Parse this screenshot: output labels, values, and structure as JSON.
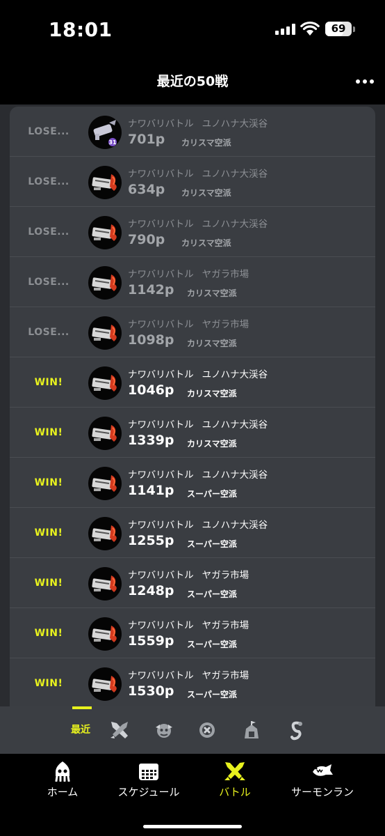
{
  "status_bar": {
    "time": "18:01",
    "battery": "69",
    "battery_fraction": 0.69
  },
  "header": {
    "title": "最近の50戦",
    "more_icon": "more-horizontal-icon"
  },
  "battles": [
    {
      "result": "LOSE...",
      "outcome": "lose",
      "mode": "ナワバリバトル",
      "stage": "ユノハナ大渓谷",
      "points": "701p",
      "rank": "カリスマ空派",
      "weapon": "weapon-gray-icon",
      "badge": "31"
    },
    {
      "result": "LOSE...",
      "outcome": "lose",
      "mode": "ナワバリバトル",
      "stage": "ユノハナ大渓谷",
      "points": "634p",
      "rank": "カリスマ空派",
      "weapon": "weapon-red-icon"
    },
    {
      "result": "LOSE...",
      "outcome": "lose",
      "mode": "ナワバリバトル",
      "stage": "ユノハナ大渓谷",
      "points": "790p",
      "rank": "カリスマ空派",
      "weapon": "weapon-red-icon"
    },
    {
      "result": "LOSE...",
      "outcome": "lose",
      "mode": "ナワバリバトル",
      "stage": "ヤガラ市場",
      "points": "1142p",
      "rank": "カリスマ空派",
      "weapon": "weapon-red-icon"
    },
    {
      "result": "LOSE...",
      "outcome": "lose",
      "mode": "ナワバリバトル",
      "stage": "ヤガラ市場",
      "points": "1098p",
      "rank": "カリスマ空派",
      "weapon": "weapon-red-icon"
    },
    {
      "result": "WIN!",
      "outcome": "win",
      "mode": "ナワバリバトル",
      "stage": "ユノハナ大渓谷",
      "points": "1046p",
      "rank": "カリスマ空派",
      "weapon": "weapon-red-icon"
    },
    {
      "result": "WIN!",
      "outcome": "win",
      "mode": "ナワバリバトル",
      "stage": "ユノハナ大渓谷",
      "points": "1339p",
      "rank": "カリスマ空派",
      "weapon": "weapon-red-icon"
    },
    {
      "result": "WIN!",
      "outcome": "win",
      "mode": "ナワバリバトル",
      "stage": "ユノハナ大渓谷",
      "points": "1141p",
      "rank": "スーパー空派",
      "weapon": "weapon-red-icon"
    },
    {
      "result": "WIN!",
      "outcome": "win",
      "mode": "ナワバリバトル",
      "stage": "ユノハナ大渓谷",
      "points": "1255p",
      "rank": "スーパー空派",
      "weapon": "weapon-red-icon"
    },
    {
      "result": "WIN!",
      "outcome": "win",
      "mode": "ナワバリバトル",
      "stage": "ヤガラ市場",
      "points": "1248p",
      "rank": "スーパー空派",
      "weapon": "weapon-red-icon"
    },
    {
      "result": "WIN!",
      "outcome": "win",
      "mode": "ナワバリバトル",
      "stage": "ヤガラ市場",
      "points": "1559p",
      "rank": "スーパー空派",
      "weapon": "weapon-red-icon"
    },
    {
      "result": "WIN!",
      "outcome": "win",
      "mode": "ナワバリバトル",
      "stage": "ヤガラ市場",
      "points": "1530p",
      "rank": "スーパー空派",
      "weapon": "weapon-red-icon"
    }
  ],
  "filters": {
    "active_label": "最近",
    "icons": [
      "regular-battle-icon",
      "anarchy-battle-icon",
      "x-battle-icon",
      "league-battle-icon",
      "private-battle-icon"
    ]
  },
  "tabs": [
    {
      "label": "ホーム",
      "icon": "squid-icon",
      "active": false
    },
    {
      "label": "スケジュール",
      "icon": "calendar-icon",
      "active": false
    },
    {
      "label": "バトル",
      "icon": "battle-icon",
      "active": true
    },
    {
      "label": "サーモンラン",
      "icon": "salmon-icon",
      "active": false
    }
  ],
  "colors": {
    "accent": "#e8f21e",
    "lose_text": "#8c8f93",
    "card_bg": "#3a3d42",
    "background": "#000000"
  }
}
